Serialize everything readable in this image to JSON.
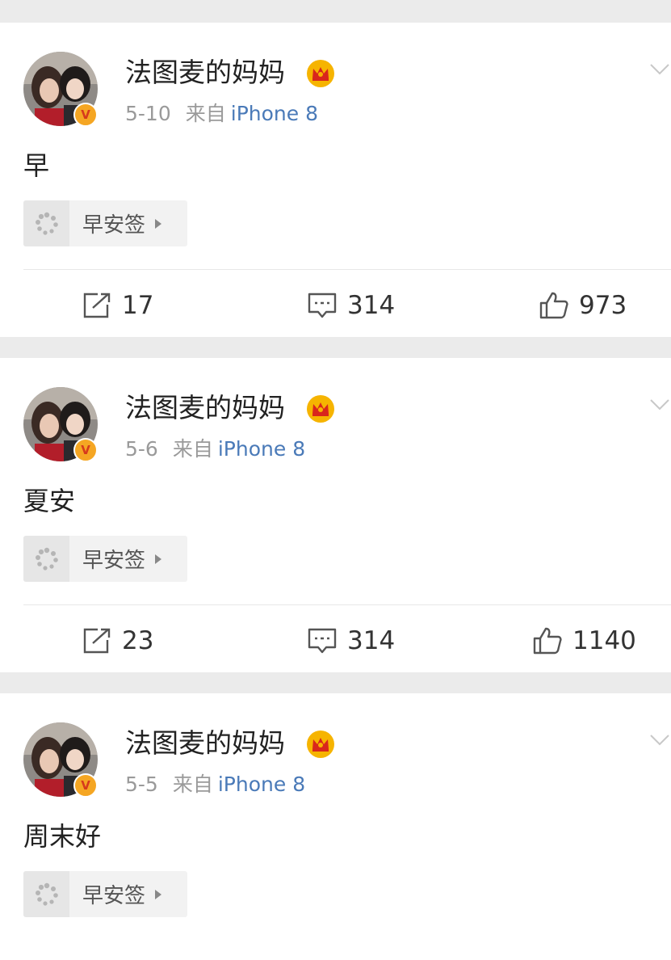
{
  "posts": [
    {
      "username": "法图麦的妈妈",
      "date": "5-10",
      "source_prefix": "来自",
      "source_name": "iPhone 8",
      "content": "早",
      "tag": "早安签",
      "reposts": "17",
      "comments": "314",
      "likes": "973"
    },
    {
      "username": "法图麦的妈妈",
      "date": "5-6",
      "source_prefix": "来自",
      "source_name": "iPhone 8",
      "content": "夏安",
      "tag": "早安签",
      "reposts": "23",
      "comments": "314",
      "likes": "1140"
    },
    {
      "username": "法图麦的妈妈",
      "date": "5-5",
      "source_prefix": "来自",
      "source_name": "iPhone 8",
      "content": "周末好",
      "tag": "早安签"
    }
  ],
  "icons": {
    "verified": "V",
    "badge": "crown-icon",
    "menu": "chevron-down-icon",
    "tag": "spinner-icon",
    "repost": "repost-icon",
    "comment": "comment-icon",
    "like": "like-icon"
  },
  "colors": {
    "source_link": "#4a7ab8",
    "verified_badge": "#f5a623",
    "background": "#ebebeb"
  }
}
